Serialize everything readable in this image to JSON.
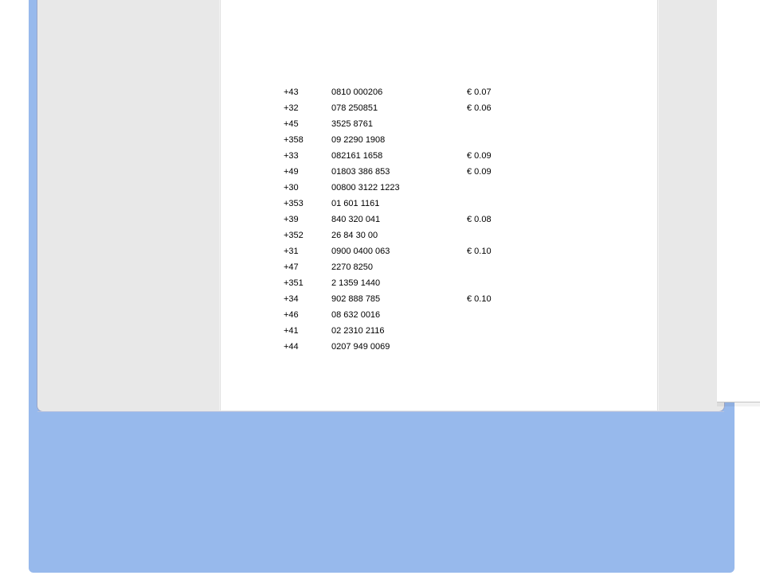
{
  "table": {
    "rows": [
      {
        "code": "+43",
        "number": "0810 000206",
        "cost": "€ 0.07"
      },
      {
        "code": "+32",
        "number": "078 250851",
        "cost": "€ 0.06"
      },
      {
        "code": "+45",
        "number": "3525 8761",
        "cost": ""
      },
      {
        "code": "+358",
        "number": "09 2290 1908",
        "cost": ""
      },
      {
        "code": "+33",
        "number": "082161 1658",
        "cost": "€ 0.09"
      },
      {
        "code": "+49",
        "number": "01803 386 853",
        "cost": "€ 0.09"
      },
      {
        "code": "+30",
        "number": "00800 3122 1223",
        "cost": ""
      },
      {
        "code": "+353",
        "number": "01 601 1161",
        "cost": ""
      },
      {
        "code": "+39",
        "number": "840 320 041",
        "cost": "€ 0.08"
      },
      {
        "code": "+352",
        "number": "26 84 30 00",
        "cost": ""
      },
      {
        "code": "+31",
        "number": "0900 0400 063",
        "cost": "€ 0.10"
      },
      {
        "code": "+47",
        "number": "2270 8250",
        "cost": ""
      },
      {
        "code": "+351",
        "number": "2 1359 1440",
        "cost": ""
      },
      {
        "code": "+34",
        "number": "902 888 785",
        "cost": "€ 0.10"
      },
      {
        "code": "+46",
        "number": "08 632 0016",
        "cost": ""
      },
      {
        "code": "+41",
        "number": "02 2310 2116",
        "cost": ""
      },
      {
        "code": "+44",
        "number": "0207 949 0069",
        "cost": ""
      }
    ]
  }
}
